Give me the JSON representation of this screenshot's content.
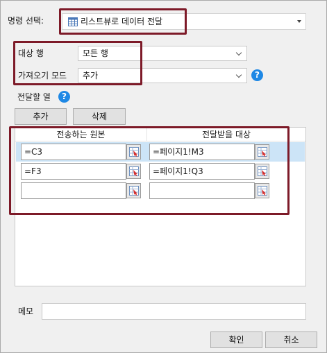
{
  "rule_select": {
    "label": "명령 선택:",
    "value": "리스트뷰로 데이터 전달",
    "icon": "table-icon"
  },
  "target_row": {
    "label": "대상 행",
    "value": "모든 행"
  },
  "import_mode": {
    "label": "가져오기 모드",
    "value": "추가",
    "help": "?"
  },
  "columns": {
    "label": "전달할 열",
    "help": "?",
    "add_label": "추가",
    "delete_label": "삭제",
    "headers": {
      "source": "전송하는 원본",
      "target": "전달받을 대상"
    },
    "rows": [
      {
        "source": "=C3",
        "target": "=페이지1!M3"
      },
      {
        "source": "=F3",
        "target": "=페이지1!Q3"
      },
      {
        "source": "",
        "target": ""
      }
    ]
  },
  "memo": {
    "label": "메모",
    "value": ""
  },
  "footer": {
    "ok_label": "확인",
    "cancel_label": "취소"
  },
  "colors": {
    "highlight": "#7d1a28",
    "selection": "#cce4f7",
    "help": "#1e88e5"
  }
}
